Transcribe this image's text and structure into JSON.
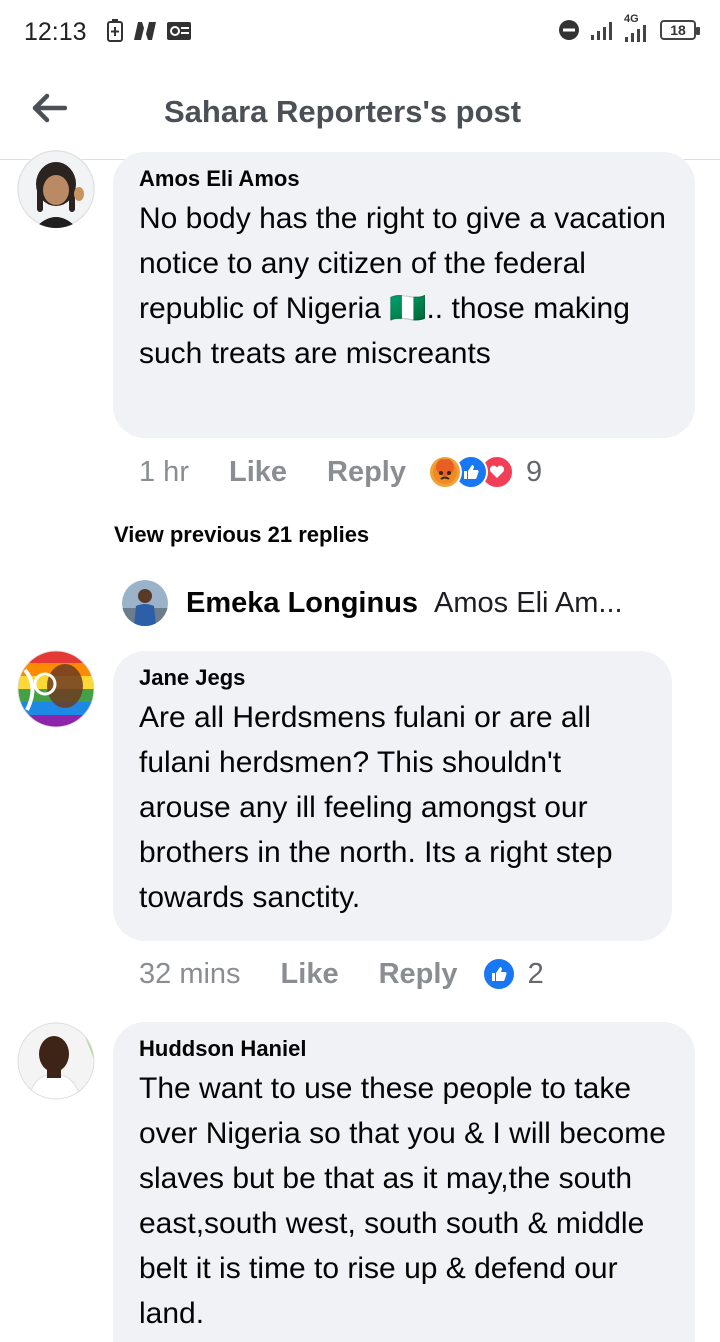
{
  "status_bar": {
    "time": "12:13",
    "network": "4G",
    "battery": "18"
  },
  "header": {
    "title": "Sahara Reporters's post"
  },
  "comments": [
    {
      "name": "Amos Eli Amos",
      "text": "No body has the right to give  a vacation notice to any citizen of the federal republic of Nigeria 🇳🇬.. those making such treats are miscreants",
      "time": "1 hr",
      "like": "Like",
      "reply": "Reply",
      "reaction_count": "9",
      "reactions": [
        "angry-icon",
        "like-icon",
        "love-icon"
      ]
    },
    {
      "name": "Jane Jegs",
      "text": "Are all Herdsmens fulani or are all fulani herdsmen? This shouldn't arouse any ill feeling amongst our brothers in the north. Its a right step towards sanctity.",
      "time": "32 mins",
      "like": "Like",
      "reply": "Reply",
      "reaction_count": "2",
      "reactions": [
        "like-icon"
      ]
    },
    {
      "name": "Huddson Haniel",
      "text": "The want to use these people to take over Nigeria so that you & I will become slaves but be that as it may,the south east,south west, south south & middle belt it is time to rise up & defend our land."
    }
  ],
  "thread": {
    "view_previous": "View previous 21 replies",
    "latest_reply": {
      "name": "Emeka Longinus",
      "text": "Amos Eli Am..."
    }
  },
  "colors": {
    "bubble": "#f0f2f5",
    "like_blue": "#1877f2",
    "love_red": "#f33e58",
    "angry_orange": "#e9710f"
  }
}
